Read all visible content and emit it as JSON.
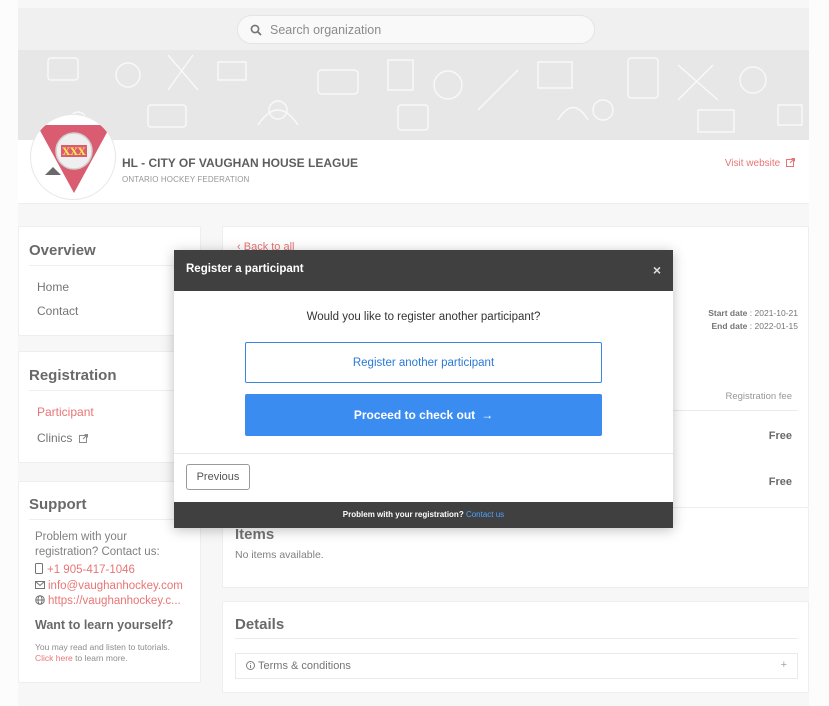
{
  "search": {
    "placeholder": "Search organization"
  },
  "org": {
    "name": "HL - CITY OF VAUGHAN HOUSE LEAGUE",
    "federation": "ONTARIO HOCKEY FEDERATION",
    "visit_label": "Visit website",
    "logo_text": "XXX"
  },
  "sidebar": {
    "overview": {
      "title": "Overview",
      "items": [
        "Home",
        "Contact"
      ]
    },
    "registration": {
      "title": "Registration",
      "items": [
        "Participant",
        "Clinics"
      ]
    },
    "support": {
      "title": "Support",
      "line1": "Problem with your",
      "line2": "registration? Contact us:",
      "phone": "+1 905-417-1046",
      "email": "info@vaughanhockey.com",
      "website": "https://vaughanhockey.c...",
      "learn_title": "Want to learn yourself?",
      "learn_text": "You may read and listen to tutorials.",
      "learn_link": "Click here",
      "learn_after": "to learn more."
    }
  },
  "main": {
    "back": "Back to all",
    "start_label": "Start date",
    "start_value": "2021-10-21",
    "end_label": "End date",
    "end_value": "2022-01-15",
    "fee_header": "Registration fee",
    "fee1": "Free",
    "fee2": "Free",
    "items_title": "Items",
    "items_empty": "No items available.",
    "details_title": "Details",
    "terms": "Terms & conditions",
    "terms_toggle": "+"
  },
  "modal": {
    "title": "Register a participant",
    "close": "×",
    "question": "Would you like to register another participant?",
    "register_another": "Register another participant",
    "checkout": "Proceed to check out",
    "checkout_arrow": "→",
    "previous": "Previous",
    "footer_text": "Problem with your registration?",
    "footer_link": "Contact us"
  },
  "colors": {
    "accent": "#3a8cf0",
    "danger": "#dd3333",
    "dark": "#404040"
  }
}
